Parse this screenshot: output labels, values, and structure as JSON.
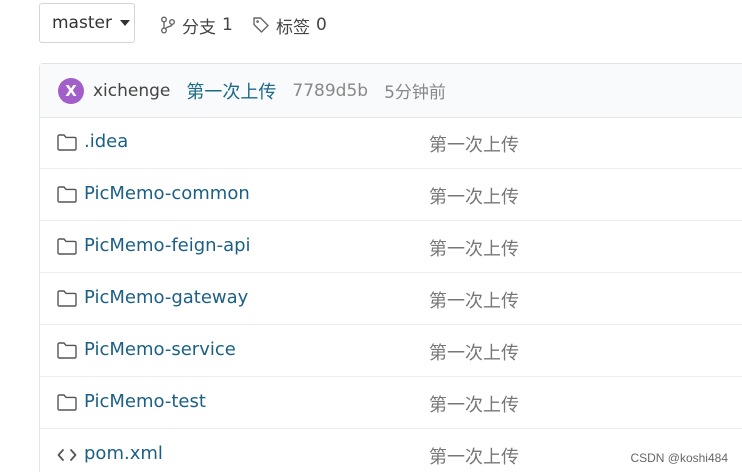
{
  "toolbar": {
    "branch_label": "master",
    "branches": {
      "label": "分支",
      "count": "1"
    },
    "tags": {
      "label": "标签",
      "count": "0"
    }
  },
  "commit": {
    "avatar_letter": "X",
    "author": "xichenge",
    "message": "第一次上传",
    "hash": "7789d5b",
    "time": "5分钟前"
  },
  "files": [
    {
      "name": ".idea",
      "type": "folder",
      "message": "第一次上传"
    },
    {
      "name": "PicMemo-common",
      "type": "folder",
      "message": "第一次上传"
    },
    {
      "name": "PicMemo-feign-api",
      "type": "folder",
      "message": "第一次上传"
    },
    {
      "name": "PicMemo-gateway",
      "type": "folder",
      "message": "第一次上传"
    },
    {
      "name": "PicMemo-service",
      "type": "folder",
      "message": "第一次上传"
    },
    {
      "name": "PicMemo-test",
      "type": "folder",
      "message": "第一次上传"
    },
    {
      "name": "pom.xml",
      "type": "file",
      "message": "第一次上传"
    }
  ],
  "watermark": "CSDN @koshi484",
  "colors": {
    "avatar": "#a25ec9",
    "link": "#1b5f86",
    "commit_message": "#1b6a8a"
  }
}
